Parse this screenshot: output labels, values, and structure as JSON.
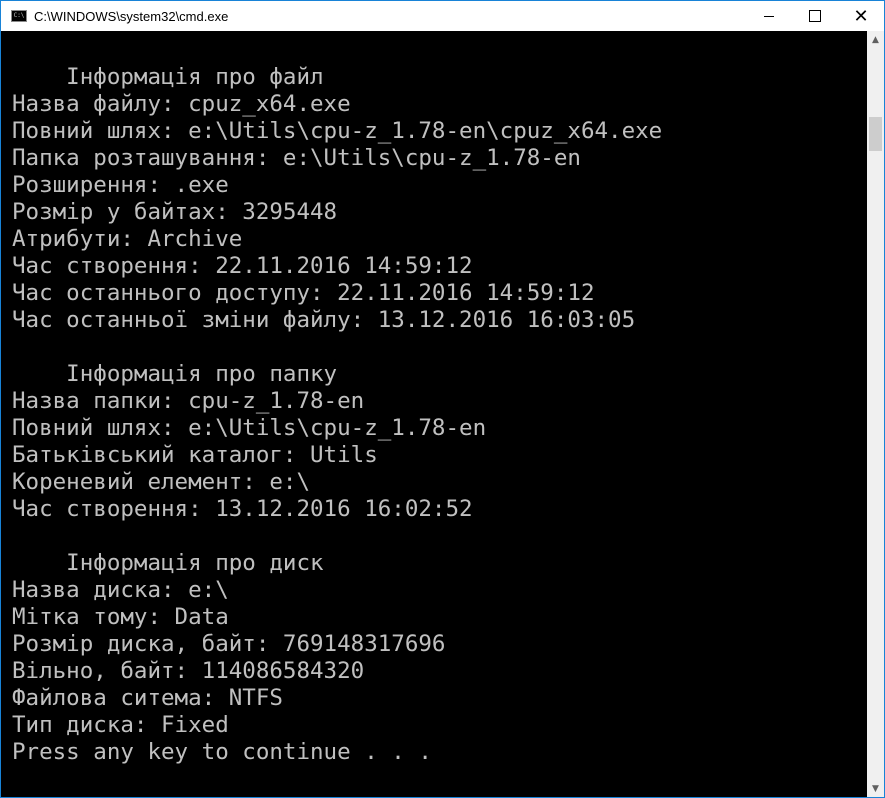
{
  "window": {
    "title": "C:\\WINDOWS\\system32\\cmd.exe",
    "icon_text": "C:\\"
  },
  "controls": {
    "minimize": "minimize-icon",
    "maximize": "maximize-icon",
    "close_glyph": "✕"
  },
  "scrollbar": {
    "up_glyph": "▲",
    "down_glyph": "▼"
  },
  "console": {
    "lines": [
      "    Інформація про файл",
      "Назва файлу: cpuz_x64.exe",
      "Повний шлях: e:\\Utils\\cpu-z_1.78-en\\cpuz_x64.exe",
      "Папка розташування: e:\\Utils\\cpu-z_1.78-en",
      "Розширення: .exe",
      "Розмір у байтах: 3295448",
      "Атрибути: Archive",
      "Час створення: 22.11.2016 14:59:12",
      "Час останнього доступу: 22.11.2016 14:59:12",
      "Час останньої зміни файлу: 13.12.2016 16:03:05",
      "",
      "    Інформація про папку",
      "Назва папки: cpu-z_1.78-en",
      "Повний шлях: e:\\Utils\\cpu-z_1.78-en",
      "Батьківський каталог: Utils",
      "Кореневий елемент: e:\\",
      "Час створення: 13.12.2016 16:02:52",
      "",
      "    Інформація про диск",
      "Назва диска: e:\\",
      "Мітка тому: Data",
      "Розмір диска, байт: 769148317696",
      "Вільно, байт: 114086584320",
      "Файлова ситема: NTFS",
      "Тип диска: Fixed",
      "Press any key to continue . . ."
    ]
  }
}
